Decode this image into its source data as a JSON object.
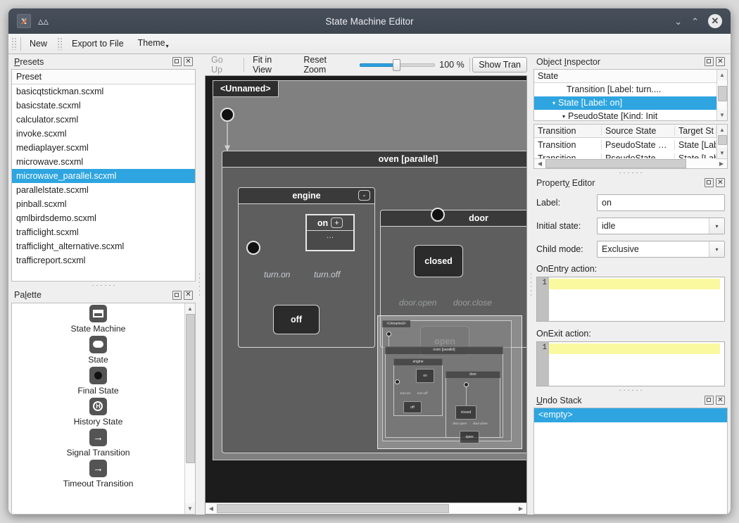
{
  "window": {
    "title": "State Machine Editor",
    "app_icon": "x-app-icon",
    "collapse_icon": "chevron-up-icon",
    "minimize_label": "⌄",
    "maximize_label": "⌃",
    "close_label": "✕"
  },
  "toolbar": {
    "items": [
      "New",
      "Export to File",
      "Theme"
    ],
    "theme_caret": "▾"
  },
  "presets": {
    "title": "Presets",
    "title_prefix": "P",
    "title_rest": "resets",
    "column_header": "Preset",
    "selected": "microwave_parallel.scxml",
    "items": [
      "basicqtstickman.scxml",
      "basicstate.scxml",
      "calculator.scxml",
      "invoke.scxml",
      "mediaplayer.scxml",
      "microwave.scxml",
      "microwave_parallel.scxml",
      "parallelstate.scxml",
      "pinball.scxml",
      "qmlbirdsdemo.scxml",
      "trafficlight.scxml",
      "trafficlight_alternative.scxml",
      "trafficreport.scxml"
    ]
  },
  "palette": {
    "title": "Palette",
    "title_prefix": "Pa",
    "title_mid": "l",
    "title_rest": "ette",
    "items": [
      {
        "label": "State Machine",
        "icon": "state-machine-icon"
      },
      {
        "label": "State",
        "icon": "state-icon"
      },
      {
        "label": "Final State",
        "icon": "final-state-icon"
      },
      {
        "label": "History State",
        "icon": "history-state-icon",
        "glyph": "H"
      },
      {
        "label": "Signal Transition",
        "icon": "signal-transition-icon",
        "glyph": "→"
      },
      {
        "label": "Timeout Transition",
        "icon": "timeout-transition-icon",
        "glyph": "→"
      }
    ]
  },
  "canvas_toolbar": {
    "go_up": "Go Up",
    "fit_in_view": "Fit in View",
    "reset_zoom": "Reset Zoom",
    "zoom_percent": "100 %",
    "show_transitions": "Show Tran",
    "slider_value": 100
  },
  "diagram": {
    "root_label": "<Unnamed>",
    "oven": {
      "label": "oven [parallel]",
      "collapse": "-"
    },
    "engine": {
      "label": "engine",
      "collapse": "-"
    },
    "door": {
      "label": "door",
      "collapse": "-"
    },
    "state_on": {
      "label": "on",
      "expand": "+",
      "ellipsis": "…"
    },
    "state_off": {
      "label": "off"
    },
    "state_closed": {
      "label": "closed"
    },
    "state_open": {
      "label": "open"
    },
    "edges": [
      {
        "label": "turn.on"
      },
      {
        "label": "turn.off"
      },
      {
        "label": "door.open"
      },
      {
        "label": "door.close"
      }
    ]
  },
  "minimap": {
    "root_label": "<Unnamed>",
    "oven": "oven [parallel]",
    "engine": "engine",
    "door": "door",
    "on": "on",
    "on_plus": "+",
    "on_ellipsis": "...",
    "off": "off",
    "closed": "closed",
    "open": "open",
    "turn_on": "turn.on",
    "turn_off": "turn.off",
    "door_open": "door.open",
    "door_close": "door.close",
    "engine_collapse": "-",
    "door_collapse": "-"
  },
  "object_inspector": {
    "title": "Object Inspector",
    "title_prefix": "Object ",
    "title_u": "I",
    "title_rest": "nspector",
    "tree_header": "State",
    "rows": [
      {
        "label": "Transition [Label: turn....",
        "indent": 46,
        "triangle": "",
        "selected": false
      },
      {
        "label": "State [Label: on]",
        "indent": 26,
        "triangle": "▾",
        "selected": true
      },
      {
        "label": "PseudoState [Kind: Init",
        "indent": 40,
        "triangle": "▾",
        "selected": false
      }
    ],
    "table": {
      "columns": [
        "Transition",
        "Source State",
        "Target St"
      ],
      "rows": [
        [
          "Transition",
          "PseudoState …",
          "State [Lab"
        ],
        [
          "Transition",
          "PseudoState …",
          "State [Lab"
        ]
      ]
    }
  },
  "property_editor": {
    "title": "Property Editor",
    "title_prefix": "Propert",
    "title_u": "y",
    "title_rest": " Editor",
    "label_field": {
      "label": "Label:",
      "value": "on"
    },
    "initial_state": {
      "label": "Initial state:",
      "value": "idle",
      "arrow": "▾"
    },
    "child_mode": {
      "label": "Child mode:",
      "value": "Exclusive",
      "arrow": "▾"
    },
    "onentry": {
      "label": "OnEntry action:",
      "line_no": "1",
      "value": ""
    },
    "onexit": {
      "label": "OnExit action:",
      "line_no": "1",
      "value": ""
    }
  },
  "undo_stack": {
    "title": "Undo Stack",
    "title_u": "U",
    "title_rest": "ndo Stack",
    "items": [
      "<empty>"
    ],
    "selected": "<empty>"
  },
  "colors": {
    "accent": "#2ea5e0",
    "panel": "#efefef",
    "titlebar": "#3e4651",
    "canvas_bg": "#1c1c1c",
    "highlight_yellow": "#fbf9a0"
  }
}
